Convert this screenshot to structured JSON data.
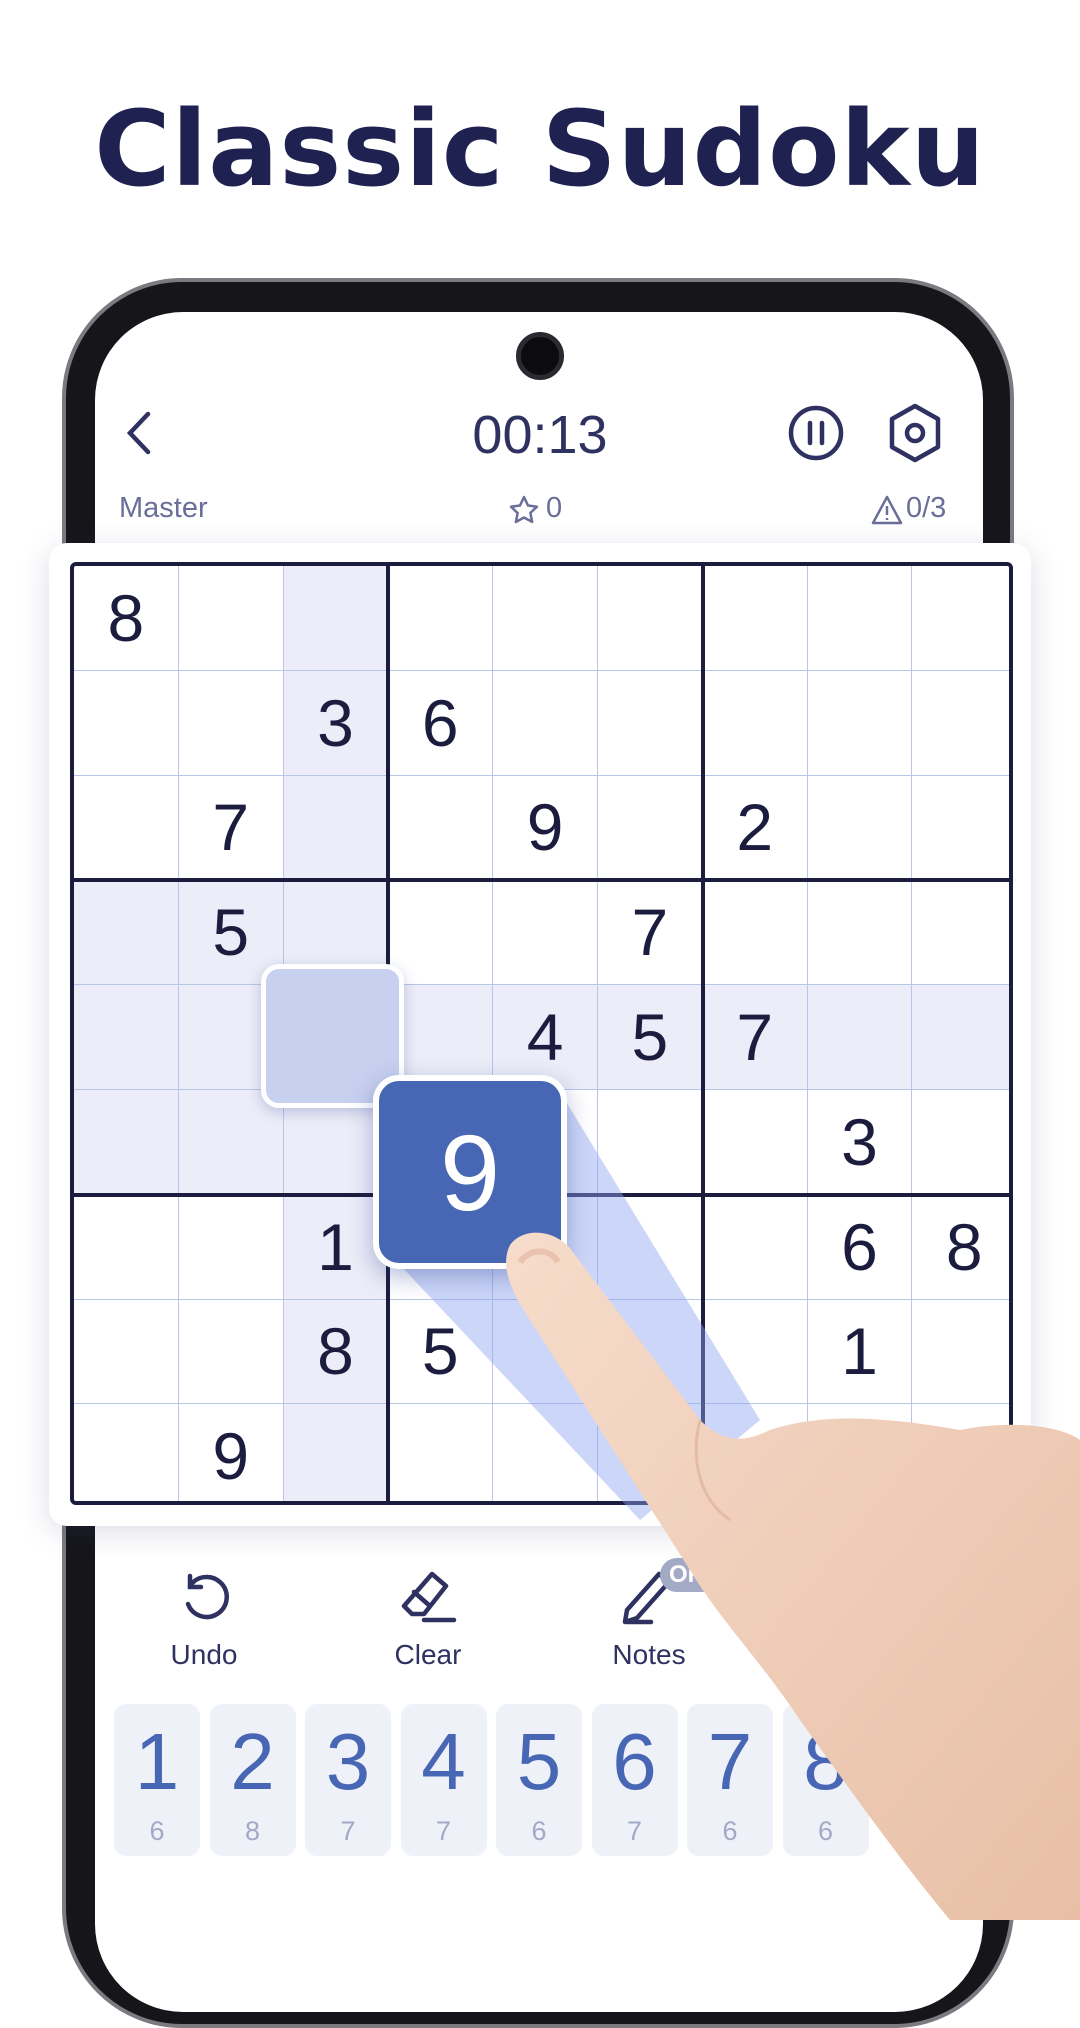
{
  "title": "Classic Sudoku",
  "header": {
    "timer": "00:13",
    "difficulty": "Master",
    "score": "0",
    "mistakes": "0/3",
    "icons": [
      "back-chevron-icon",
      "pause-icon",
      "settings-icon",
      "star-icon",
      "warning-icon"
    ]
  },
  "board": {
    "grid": [
      [
        8,
        0,
        0,
        0,
        0,
        0,
        0,
        0,
        0
      ],
      [
        0,
        0,
        3,
        6,
        0,
        0,
        0,
        0,
        0
      ],
      [
        0,
        7,
        0,
        0,
        9,
        0,
        2,
        0,
        0
      ],
      [
        0,
        5,
        0,
        0,
        0,
        7,
        0,
        0,
        0
      ],
      [
        0,
        0,
        0,
        0,
        4,
        5,
        7,
        0,
        0
      ],
      [
        0,
        0,
        0,
        0,
        0,
        0,
        0,
        3,
        0
      ],
      [
        0,
        0,
        1,
        0,
        0,
        0,
        0,
        6,
        8
      ],
      [
        0,
        0,
        8,
        5,
        0,
        0,
        0,
        1,
        0
      ],
      [
        0,
        9,
        0,
        0,
        0,
        0,
        0,
        0,
        0
      ]
    ],
    "selected": {
      "row": 5,
      "col": 3
    },
    "dragged_value": "9"
  },
  "toolbar": {
    "undo": "Undo",
    "clear": "Clear",
    "notes": "Notes",
    "notes_state": "OFF"
  },
  "numpad": [
    {
      "digit": "1",
      "remaining": "6"
    },
    {
      "digit": "2",
      "remaining": "8"
    },
    {
      "digit": "3",
      "remaining": "7"
    },
    {
      "digit": "4",
      "remaining": "7"
    },
    {
      "digit": "5",
      "remaining": "6"
    },
    {
      "digit": "6",
      "remaining": "7"
    },
    {
      "digit": "7",
      "remaining": "6"
    },
    {
      "digit": "8",
      "remaining": "6"
    }
  ],
  "colors": {
    "accent": "#4766b4",
    "text": "#1f2250",
    "highlight": "#ecedf8",
    "selected": "#c7d0ef"
  }
}
